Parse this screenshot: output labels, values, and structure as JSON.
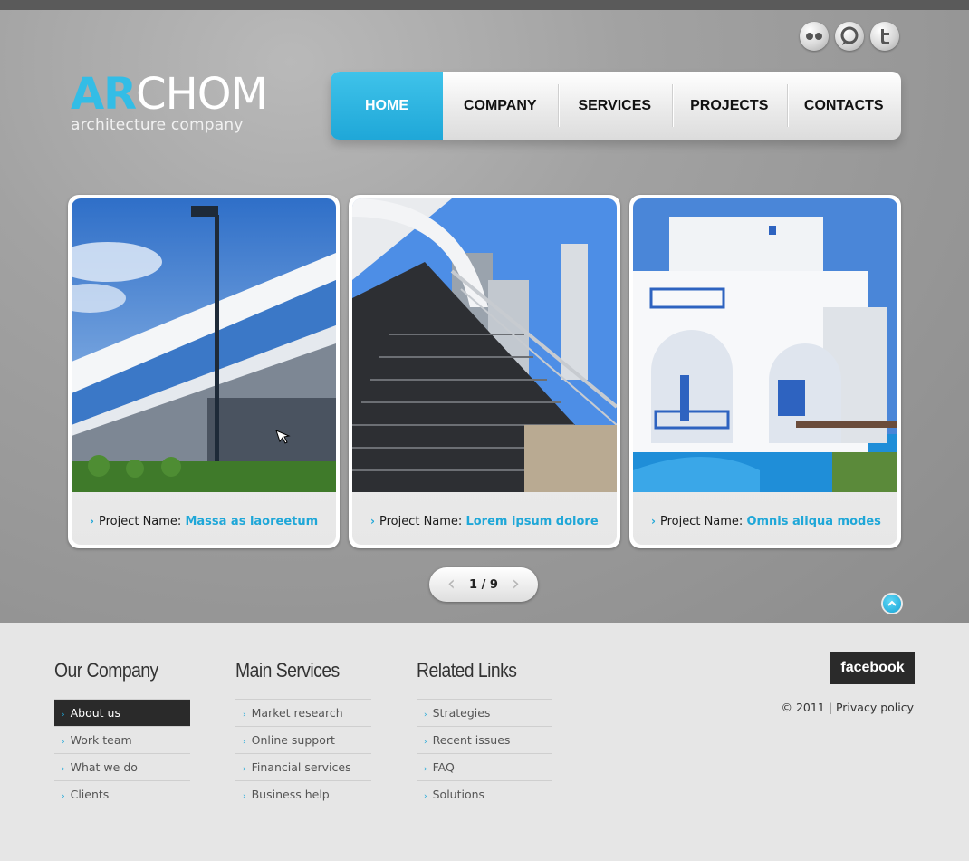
{
  "brand": {
    "logo_accent": "AR",
    "logo_rest": "CHOM",
    "tagline": "architecture company"
  },
  "social": [
    "flickr-icon",
    "chat-icon",
    "twitter-icon"
  ],
  "nav": {
    "items": [
      {
        "label": "HOME",
        "active": true
      },
      {
        "label": "COMPANY"
      },
      {
        "label": "SERVICES"
      },
      {
        "label": "PROJECTS"
      },
      {
        "label": "CONTACTS"
      }
    ]
  },
  "projects": [
    {
      "prefix": "Project Name:",
      "name": "Massa as laoreetum"
    },
    {
      "prefix": "Project Name:",
      "name": "Lorem ipsum dolore"
    },
    {
      "prefix": "Project Name:",
      "name": "Omnis aliqua modes"
    }
  ],
  "pager": {
    "text": "1 / 9"
  },
  "footer": {
    "columns": [
      {
        "title": "Our Company",
        "items": [
          "About us",
          "Work team",
          "What we do",
          "Clients"
        ],
        "active_index": 0
      },
      {
        "title": "Main Services",
        "items": [
          "Market research",
          "Online support",
          "Financial services",
          "Business help"
        ]
      },
      {
        "title": "Related Links",
        "items": [
          "Strategies",
          "Recent issues",
          "FAQ",
          "Solutions"
        ]
      }
    ],
    "facebook_label": "facebook",
    "copyright": "© 2011",
    "separator": "|",
    "privacy_label": "Privacy policy"
  },
  "colors": {
    "accent": "#1fa7d8",
    "dark": "#2a2a2a"
  }
}
